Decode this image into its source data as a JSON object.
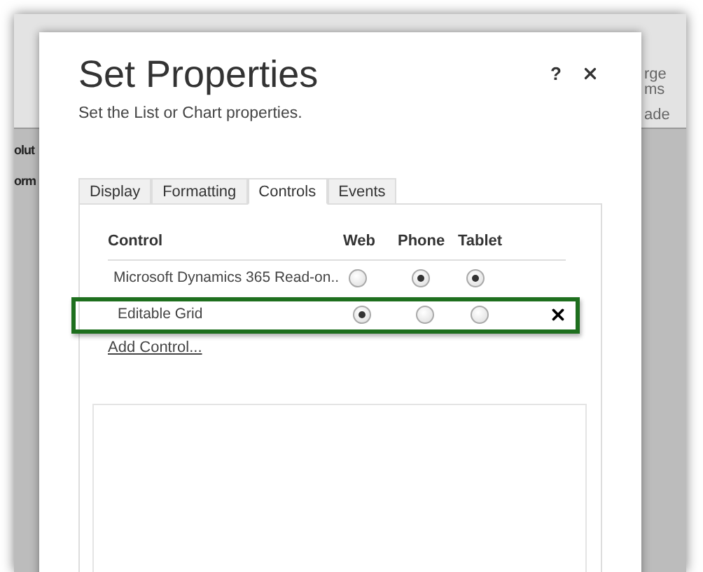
{
  "background": {
    "left_labels": [
      "olut",
      "orm"
    ],
    "right_labels": [
      "rge",
      "ms",
      "ade"
    ]
  },
  "dialog": {
    "title": "Set Properties",
    "subtitle": "Set the List or Chart properties.",
    "help": "?"
  },
  "tabs": [
    {
      "label": "Display",
      "selected": false
    },
    {
      "label": "Formatting",
      "selected": false
    },
    {
      "label": "Controls",
      "selected": true
    },
    {
      "label": "Events",
      "selected": false
    }
  ],
  "table": {
    "columns": [
      "Control",
      "Web",
      "Phone",
      "Tablet"
    ],
    "rows": [
      {
        "name": "Microsoft Dynamics 365 Read-on..",
        "options": [
          {
            "checked": false
          },
          {
            "checked": true
          },
          {
            "checked": true
          }
        ],
        "highlighted": false,
        "removable": false
      },
      {
        "name": "Editable Grid",
        "options": [
          {
            "checked": true
          },
          {
            "checked": false
          },
          {
            "checked": false
          }
        ],
        "highlighted": true,
        "removable": true
      }
    ]
  },
  "add_link": "Add Control..."
}
